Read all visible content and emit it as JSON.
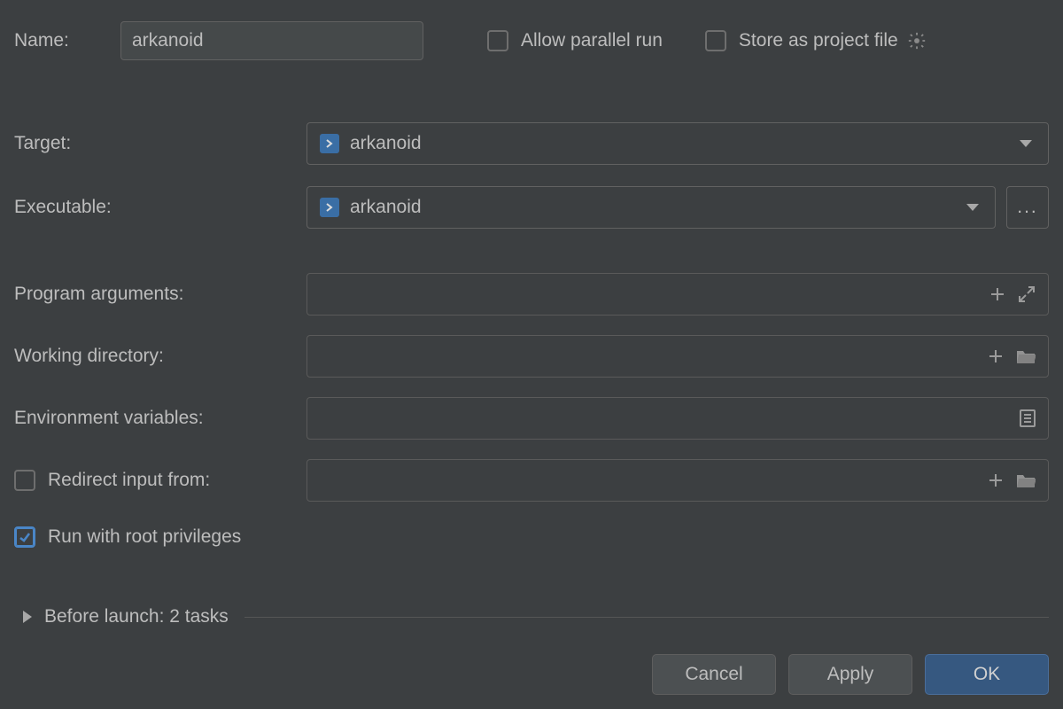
{
  "header": {
    "name_label": "Name:",
    "name_value": "arkanoid",
    "allow_parallel_label": "Allow parallel run",
    "allow_parallel_checked": false,
    "store_file_label": "Store as project file",
    "store_file_checked": false
  },
  "fields": {
    "target_label": "Target:",
    "target_value": "arkanoid",
    "executable_label": "Executable:",
    "executable_value": "arkanoid",
    "program_args_label": "Program arguments:",
    "program_args_value": "",
    "working_dir_label": "Working directory:",
    "working_dir_value": "",
    "env_vars_label": "Environment variables:",
    "env_vars_value": "",
    "redirect_label": "Redirect input from:",
    "redirect_checked": false,
    "redirect_value": "",
    "root_label": "Run with root privileges",
    "root_checked": true
  },
  "before_launch": {
    "title": "Before launch: 2 tasks"
  },
  "buttons": {
    "cancel": "Cancel",
    "apply": "Apply",
    "ok": "OK"
  }
}
